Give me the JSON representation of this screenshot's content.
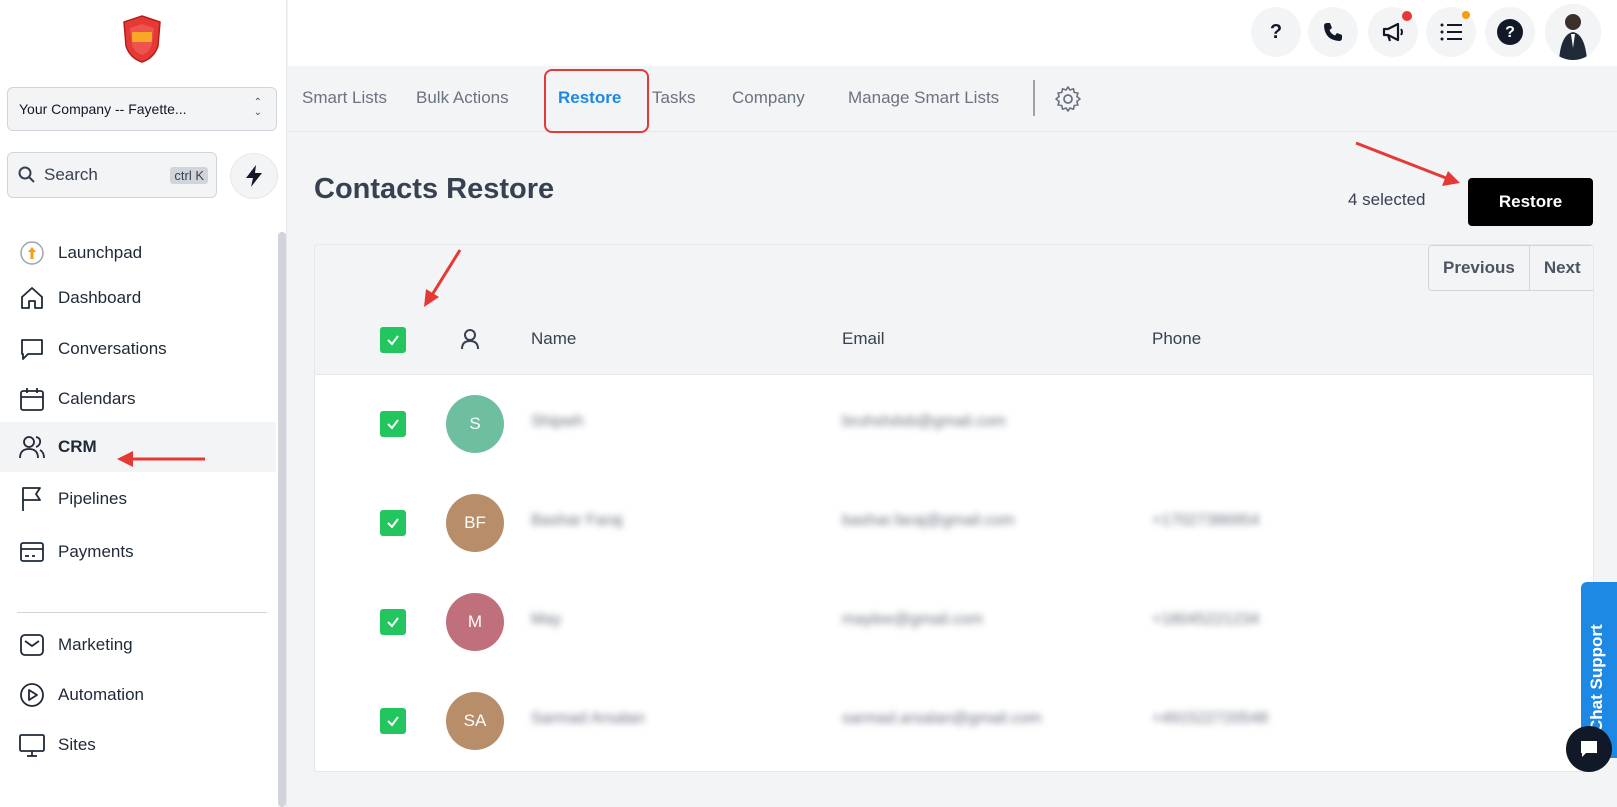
{
  "sidebar": {
    "company": "Your Company -- Fayette...",
    "search_placeholder": "Search",
    "search_shortcut": "ctrl K",
    "items": [
      {
        "label": "Launchpad",
        "icon": "launchpad-icon"
      },
      {
        "label": "Dashboard",
        "icon": "home-icon"
      },
      {
        "label": "Conversations",
        "icon": "chat-icon"
      },
      {
        "label": "Calendars",
        "icon": "calendar-icon"
      },
      {
        "label": "CRM",
        "icon": "users-icon",
        "active": true
      },
      {
        "label": "Pipelines",
        "icon": "flag-icon"
      },
      {
        "label": "Payments",
        "icon": "card-icon"
      },
      {
        "label": "Marketing",
        "icon": "mail-icon"
      },
      {
        "label": "Automation",
        "icon": "play-icon"
      },
      {
        "label": "Sites",
        "icon": "monitor-icon"
      }
    ]
  },
  "topbar": {
    "icons": [
      "question-icon",
      "phone-icon",
      "megaphone-icon",
      "list-icon",
      "help-icon",
      "user-avatar"
    ],
    "help_label": "?"
  },
  "tabs": [
    "Smart Lists",
    "Bulk Actions",
    "Restore",
    "Tasks",
    "Company",
    "Manage Smart Lists"
  ],
  "active_tab": "Restore",
  "main": {
    "title": "Contacts Restore",
    "selected": "4 selected",
    "restore_label": "Restore",
    "previous_label": "Previous",
    "next_label": "Next"
  },
  "table": {
    "columns": [
      "Name",
      "Email",
      "Phone"
    ],
    "rows": [
      {
        "initials": "S",
        "color": "#6dbfa0",
        "name": "Shipwh",
        "email": "bruhshdsb@gmail.com",
        "phone": ""
      },
      {
        "initials": "BF",
        "color": "#b88e6a",
        "name": "Bashar Faraj",
        "email": "bashar.faraj@gmail.com",
        "phone": "+17027386954"
      },
      {
        "initials": "M",
        "color": "#c0707a",
        "name": "May",
        "email": "maylee@gmail.com",
        "phone": "+18045221234"
      },
      {
        "initials": "SA",
        "color": "#b88e6a",
        "name": "Sarmad Arsalan",
        "email": "sarmad.arsalan@gmail.com",
        "phone": "+491522720548"
      }
    ]
  },
  "chat_support": "Chat Support",
  "colors": {
    "accent": "#1e88e5",
    "checkbox": "#22c55e",
    "highlight": "#e53935"
  }
}
